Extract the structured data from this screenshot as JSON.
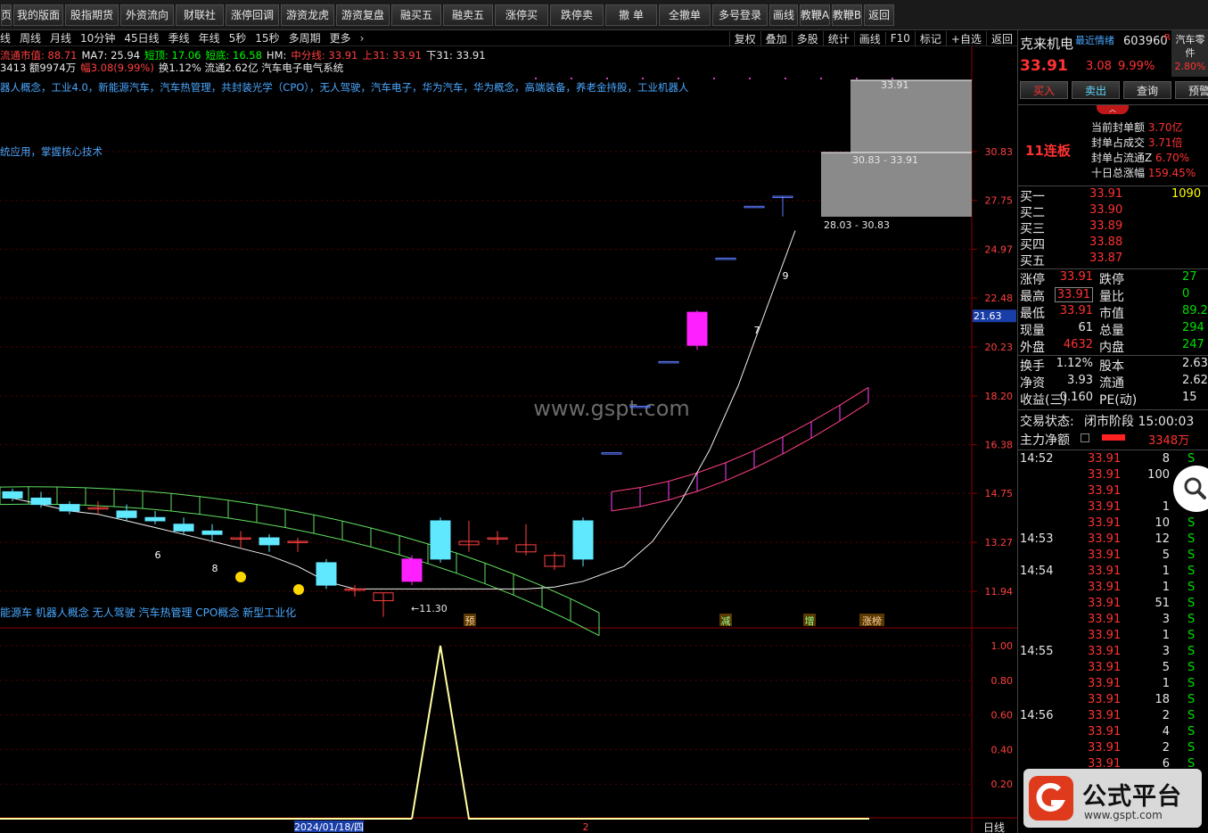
{
  "toolbar": [
    "页",
    "我的版面",
    "股指期货",
    "外资流向",
    "财联社",
    "涨停回调",
    "游资龙虎",
    "游资复盘",
    "融买五",
    "融卖五",
    "涨停买",
    "跌停卖",
    "撤 单",
    "全撤单",
    "多号登录",
    "画线",
    "教鞭A",
    "教鞭B",
    "返回"
  ],
  "periods": [
    "线",
    "周线",
    "月线",
    "10分钟",
    "45日线",
    "季线",
    "年线",
    "5秒",
    "15秒",
    "多周期",
    "更多"
  ],
  "tools": [
    "复权",
    "叠加",
    "多股",
    "统计",
    "画线",
    "F10",
    "标记",
    "+自选",
    "返回"
  ],
  "info": {
    "line1": [
      {
        "t": "流通市值: 88.71",
        "c": "#ff4040"
      },
      {
        "t": "MA7: 25.94",
        "c": "#e8e8e8"
      },
      {
        "t": "短顶: 17.06",
        "c": "#00ff00"
      },
      {
        "t": "短底: 16.58",
        "c": "#00ff00"
      },
      {
        "t": "HM:",
        "c": "#e8e8e8"
      },
      {
        "t": "中分线: 33.91",
        "c": "#ff4040"
      },
      {
        "t": "上31: 33.91",
        "c": "#ff4040"
      },
      {
        "t": "下31: 33.91",
        "c": "#e8e8e8"
      }
    ],
    "line2": [
      {
        "t": "3413 额9974万",
        "c": "#e8e8e8"
      },
      {
        "t": "幅3.08(9.99%)",
        "c": "#ff4040"
      },
      {
        "t": "换1.12% 流通2.62亿 汽车电子电气系统",
        "c": "#e8e8e8"
      }
    ],
    "concepts": "器人概念，工业4.0，新能源汽车，汽车热管理，共封装光学（CPO），无人驾驶，汽车电子，华为汽车，华为概念，高端装备，养老金持股，工业机器人",
    "note": "统应用，掌握核心技术",
    "bottom_concepts": "能源车 机器人概念 无人驾驶 汽车热管理 CPO概念 新型工业化"
  },
  "axis": {
    "price_labels": [
      "30.83",
      "27.75",
      "24.97",
      "22.48",
      "20.23",
      "18.20",
      "16.38",
      "14.75",
      "13.27",
      "11.94"
    ],
    "current_price_tag": "21.63",
    "low_annotation": "←11.30",
    "chip_labels": [
      "33.91",
      "30.83 - 33.91",
      "28.03 - 30.83"
    ],
    "markers": [
      "预",
      "减",
      "增",
      "涨榜"
    ],
    "indicator_labels": [
      "1.00",
      "0.80",
      "0.60",
      "0.40",
      "0.20"
    ],
    "date_label": "2024/01/18/四",
    "date_tick": "2",
    "period_label": "日线",
    "watermark": "www.gspt.com"
  },
  "chart_data": {
    "type": "candlestick",
    "prices": {
      "open": [
        14.8,
        14.6,
        14.4,
        14.3,
        14.2,
        14.0,
        13.8,
        13.6,
        13.4,
        13.4,
        13.3,
        12.7,
        12.0,
        11.7,
        12.2,
        13.9,
        13.2,
        13.4,
        13.0,
        12.6,
        13.9,
        16.1,
        17.8,
        19.6,
        21.8,
        24.5,
        27.4,
        28.0
      ],
      "close": [
        14.6,
        14.4,
        14.2,
        14.3,
        14.0,
        13.9,
        13.6,
        13.5,
        13.4,
        13.2,
        13.3,
        12.1,
        12.0,
        11.9,
        12.8,
        12.8,
        13.3,
        13.4,
        13.2,
        12.9,
        12.8,
        16.1,
        17.8,
        19.6,
        20.3,
        24.5,
        27.4,
        28.0
      ],
      "high": [
        14.9,
        14.8,
        14.5,
        14.5,
        14.4,
        14.2,
        14.0,
        13.8,
        13.6,
        13.5,
        13.4,
        12.8,
        12.1,
        11.9,
        12.9,
        14.0,
        13.9,
        13.6,
        13.8,
        13.0,
        14.0,
        16.1,
        17.8,
        19.6,
        21.9,
        24.5,
        27.4,
        28.0
      ],
      "low": [
        14.5,
        14.3,
        14.1,
        14.1,
        13.9,
        13.8,
        13.5,
        13.3,
        13.1,
        13.0,
        13.0,
        12.0,
        11.8,
        11.3,
        12.1,
        12.7,
        13.0,
        13.2,
        12.9,
        12.5,
        12.6,
        16.1,
        17.8,
        19.6,
        20.1,
        24.5,
        27.4,
        26.8
      ]
    },
    "last_price": 33.91,
    "indicator": {
      "x": [
        0,
        1,
        2,
        3,
        4,
        5,
        6,
        7,
        8,
        9,
        10,
        11,
        12,
        13,
        14,
        15,
        16,
        17,
        18,
        19,
        20,
        21,
        22,
        23,
        24,
        25,
        26,
        27,
        28,
        29
      ],
      "values": [
        0,
        0,
        0,
        0,
        0,
        0,
        0,
        0,
        0,
        0,
        0,
        0,
        0,
        0,
        0,
        1,
        0,
        0,
        0,
        0,
        0,
        0,
        0,
        0,
        0,
        0,
        0,
        0,
        0,
        0
      ]
    }
  },
  "side": {
    "name": "克来机电",
    "tag": "最近情绪",
    "code": "603960",
    "r": "R",
    "sector": "汽车零件",
    "sector_pct": "2.80%",
    "price": "33.91",
    "change": "3.08",
    "pct": "9.99%",
    "buttons": [
      "买入",
      "卖出",
      "查询",
      "预警"
    ],
    "streak": "11连板",
    "seal": [
      {
        "k": "当前封单额",
        "v": "3.70亿"
      },
      {
        "k": "封单占成交",
        "v": "3.71倍"
      },
      {
        "k": "封单占流通Z",
        "v": "6.70%"
      },
      {
        "k": "十日总涨幅",
        "v": "159.45%"
      }
    ],
    "bids": [
      {
        "k": "买一",
        "p": "33.91",
        "v": "1090"
      },
      {
        "k": "买二",
        "p": "33.90",
        "v": ""
      },
      {
        "k": "买三",
        "p": "33.89",
        "v": ""
      },
      {
        "k": "买四",
        "p": "33.88",
        "v": ""
      },
      {
        "k": "买五",
        "p": "33.87",
        "v": ""
      }
    ],
    "stats": [
      {
        "a": "涨停",
        "b": "33.91",
        "c": "跌停",
        "d": "27"
      },
      {
        "a": "最高",
        "b": "33.91",
        "c": "量比",
        "d": "0"
      },
      {
        "a": "最低",
        "b": "33.91",
        "c": "市值",
        "d": "89.2"
      },
      {
        "a": "现量",
        "b": "61",
        "c": "总量",
        "d": "294"
      },
      {
        "a": "外盘",
        "b": "4632",
        "c": "内盘",
        "d": "247"
      }
    ],
    "stats2": [
      {
        "a": "换手",
        "b": "1.12%",
        "c": "股本",
        "d": "2.63"
      },
      {
        "a": "净资",
        "b": "3.93",
        "c": "流通",
        "d": "2.62"
      },
      {
        "a": "收益(三)",
        "b": "0.160",
        "c": "PE(动)",
        "d": "15"
      }
    ],
    "status_label": "交易状态:",
    "status_value": "闭市阶段 15:00:03",
    "flow_label": "主力净额",
    "flow_value": "3348万",
    "ticks": [
      {
        "t": "14:52",
        "p": "33.91",
        "v": "8",
        "s": "S"
      },
      {
        "t": "",
        "p": "33.91",
        "v": "100",
        "s": ""
      },
      {
        "t": "",
        "p": "33.91",
        "v": "",
        "s": "S"
      },
      {
        "t": "",
        "p": "33.91",
        "v": "1",
        "s": "S"
      },
      {
        "t": "",
        "p": "33.91",
        "v": "10",
        "s": "S"
      },
      {
        "t": "14:53",
        "p": "33.91",
        "v": "12",
        "s": "S"
      },
      {
        "t": "",
        "p": "33.91",
        "v": "5",
        "s": "S"
      },
      {
        "t": "14:54",
        "p": "33.91",
        "v": "1",
        "s": "S"
      },
      {
        "t": "",
        "p": "33.91",
        "v": "1",
        "s": "S"
      },
      {
        "t": "",
        "p": "33.91",
        "v": "51",
        "s": "S"
      },
      {
        "t": "",
        "p": "33.91",
        "v": "3",
        "s": "S"
      },
      {
        "t": "",
        "p": "33.91",
        "v": "1",
        "s": "S"
      },
      {
        "t": "14:55",
        "p": "33.91",
        "v": "3",
        "s": "S"
      },
      {
        "t": "",
        "p": "33.91",
        "v": "5",
        "s": "S"
      },
      {
        "t": "",
        "p": "33.91",
        "v": "1",
        "s": "S"
      },
      {
        "t": "",
        "p": "33.91",
        "v": "18",
        "s": "S"
      },
      {
        "t": "14:56",
        "p": "33.91",
        "v": "2",
        "s": "S"
      },
      {
        "t": "",
        "p": "33.91",
        "v": "4",
        "s": "S"
      },
      {
        "t": "",
        "p": "33.91",
        "v": "2",
        "s": "S"
      },
      {
        "t": "",
        "p": "33.91",
        "v": "6",
        "s": "S"
      }
    ],
    "logo_text": "公式平台",
    "logo_url": "www.gspt.com"
  }
}
